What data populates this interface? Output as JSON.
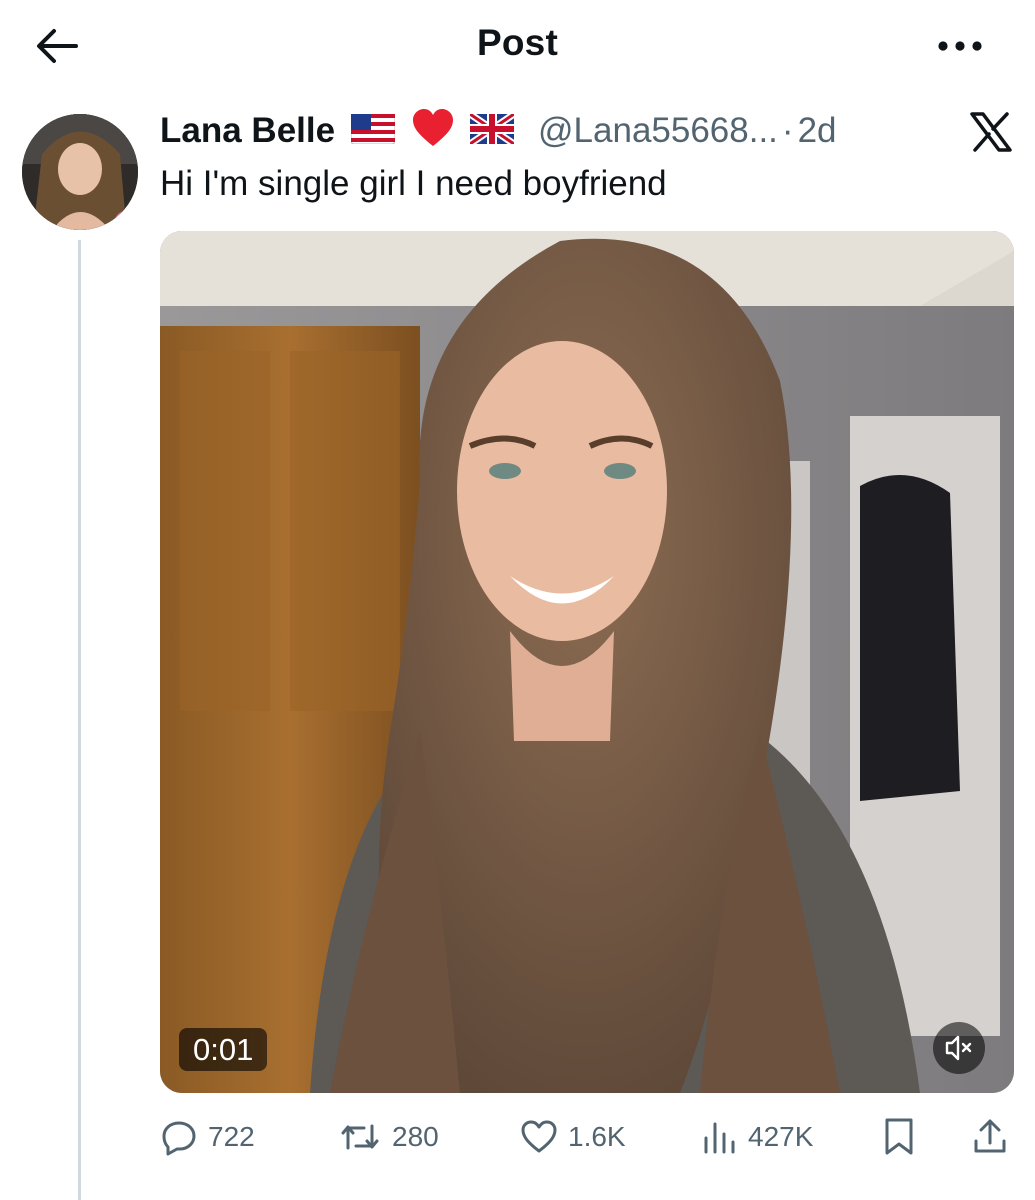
{
  "header": {
    "title": "Post"
  },
  "tweet": {
    "display_name": "Lana Belle",
    "badges": [
      "flag-us-icon",
      "red-heart-icon",
      "flag-uk-icon"
    ],
    "handle": "@Lana55668...",
    "separator": "·",
    "timestamp": "2d",
    "text": "Hi I'm single girl I need boyfriend",
    "media": {
      "type": "video",
      "duration": "0:01",
      "muted": true
    }
  },
  "actions": {
    "replies": "722",
    "reposts": "280",
    "likes": "1.6K",
    "views": "427K"
  },
  "colors": {
    "text_primary": "#0f1419",
    "text_secondary": "#536471",
    "thread_line": "#cfd9de"
  }
}
